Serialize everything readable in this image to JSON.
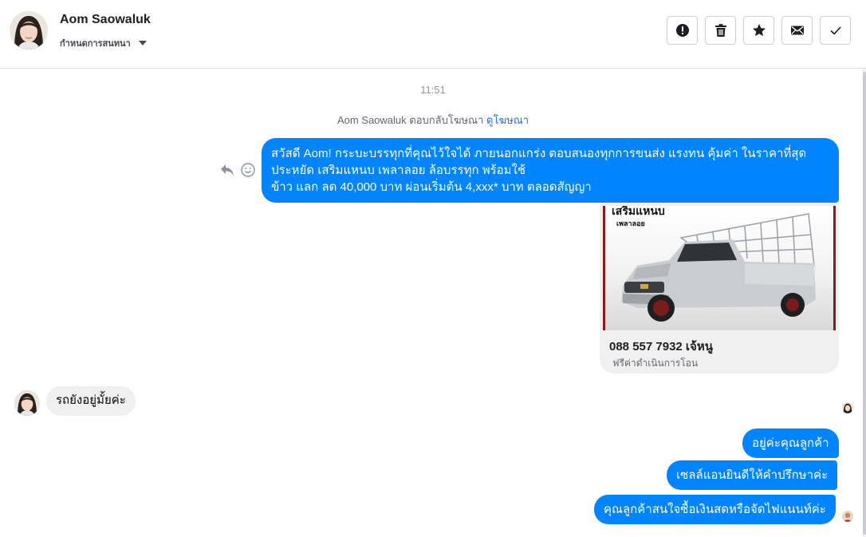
{
  "header": {
    "contact_name": "Aom Saowaluk",
    "label_picker": "กำหนดการสนทนา",
    "actions": [
      "report-spam",
      "delete",
      "star",
      "mark-unread",
      "mark-done"
    ]
  },
  "conversation": {
    "timestamp": "11:51",
    "ad_reply_note": "Aom Saowaluk ตอบกลับโฆษณา",
    "ad_link": "ดูโฆษณา",
    "messages": {
      "ad_message_line1": "สวัสดี Aom! กระบะบรรทุกที่คุณไว้ใจได้ ภายนอกแกร่ง ตอบสนองทุกการขนส่ง แรงทน คุ้มค่า ในราคาที่สุด",
      "ad_message_line2": "ประหยัด เสริมแหนบ เพลาลอย ล้อบรรทุก พร้อมใช้",
      "ad_message_line3": "ข้าว แลก ลด 40,000 บาท ผ่อนเริ่มต้น 4,xxx* บาท ตลอดสัญญา",
      "incoming": "รถยังอยู่มั้ยค่ะ",
      "reply1": "อยู่ค่ะคุณลูกค้า",
      "reply2": "เซลล์แอนยินดีให้คำปรึกษาค่ะ",
      "reply3": "คุณลูกค้าสนใจซื้อเงินสดหรือจัดไฟแนนท์ค่ะ"
    },
    "ad_card": {
      "image_caption_line1": "เสริมแหนบ",
      "image_caption_line2": "เพลาลอย",
      "title": "088 557 7932 เจ้หนู",
      "subtitle": "ฟรีค่าดำเนินการโอน"
    }
  },
  "colors": {
    "outgoing_bubble": "#0084ff",
    "incoming_bubble": "#f1f0f0",
    "link": "#216fdb"
  }
}
